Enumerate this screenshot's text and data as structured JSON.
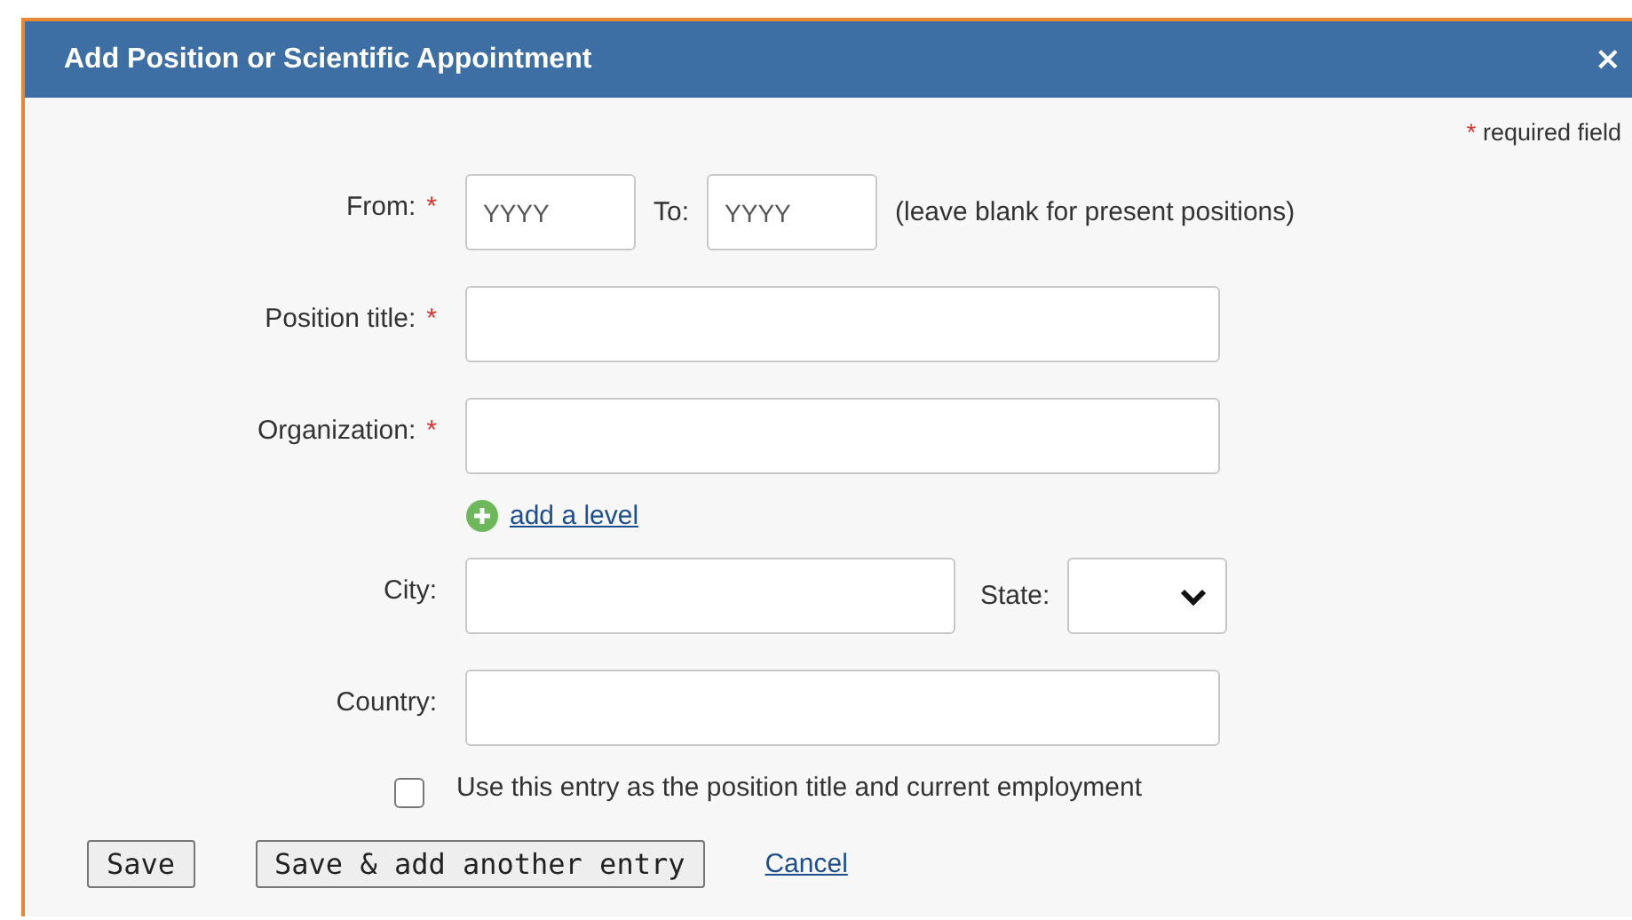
{
  "dialog": {
    "title": "Add Position or Scientific Appointment",
    "close": "×"
  },
  "required_note": {
    "mark": "*",
    "text": "required field"
  },
  "dates": {
    "from": {
      "label": "From:",
      "required": true,
      "placeholder": "YYYY"
    },
    "to": {
      "label": "To:",
      "placeholder": "YYYY"
    },
    "hint": "(leave blank for present positions)"
  },
  "position_title": {
    "label": "Position title:",
    "required": true
  },
  "organization": {
    "label": "Organization:",
    "required": true
  },
  "add_level": "add a level",
  "city": {
    "label": "City:"
  },
  "state": {
    "label": "State:"
  },
  "country": {
    "label": "Country:"
  },
  "use_entry": {
    "label": "Use this entry as the position title and current employment",
    "checked": false
  },
  "buttons": [
    {
      "label": "Save",
      "kind": "button"
    },
    {
      "label": "Save & add another entry",
      "kind": "button"
    },
    {
      "label": "Cancel",
      "kind": "link"
    }
  ]
}
